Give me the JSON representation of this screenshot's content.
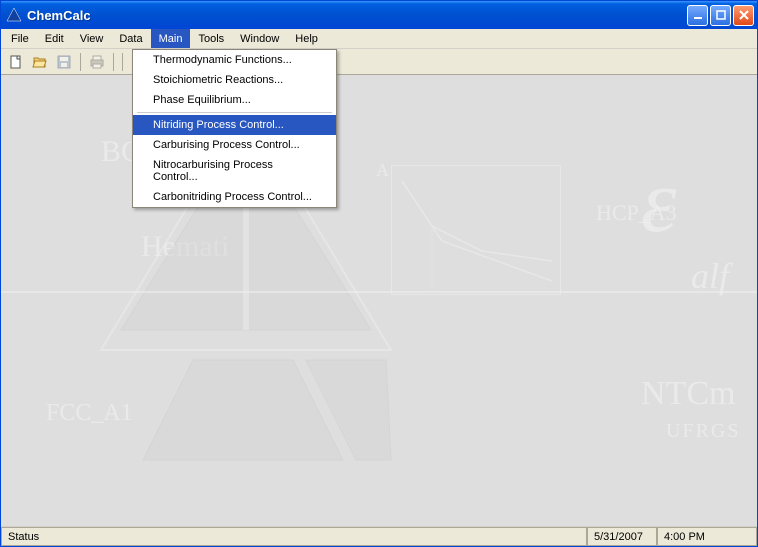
{
  "titlebar": {
    "title": "ChemCalc"
  },
  "menubar": {
    "items": [
      {
        "label": "File"
      },
      {
        "label": "Edit"
      },
      {
        "label": "View"
      },
      {
        "label": "Data"
      },
      {
        "label": "Main"
      },
      {
        "label": "Tools"
      },
      {
        "label": "Window"
      },
      {
        "label": "Help"
      }
    ],
    "open_index": 4
  },
  "dropdown": {
    "items": [
      {
        "label": "Thermodynamic Functions..."
      },
      {
        "label": "Stoichiometric Reactions..."
      },
      {
        "label": "Phase Equilibrium..."
      }
    ],
    "items2": [
      {
        "label": "Nitriding Process Control..."
      },
      {
        "label": "Carburising Process Control..."
      },
      {
        "label": "Nitrocarburising Process Control..."
      },
      {
        "label": "Carbonitriding Process Control..."
      }
    ],
    "highlight_label": "Nitriding Process Control..."
  },
  "background": {
    "bc": "BC",
    "hemat": "Hemati",
    "fcc": "FCC_A1",
    "hcp": "HCP_A3",
    "alf": "alf",
    "ntcm": "NTCm",
    "ufrgs": "UFRGS",
    "a": "A"
  },
  "statusbar": {
    "status": "Status",
    "date": "5/31/2007",
    "time": "4:00 PM"
  }
}
